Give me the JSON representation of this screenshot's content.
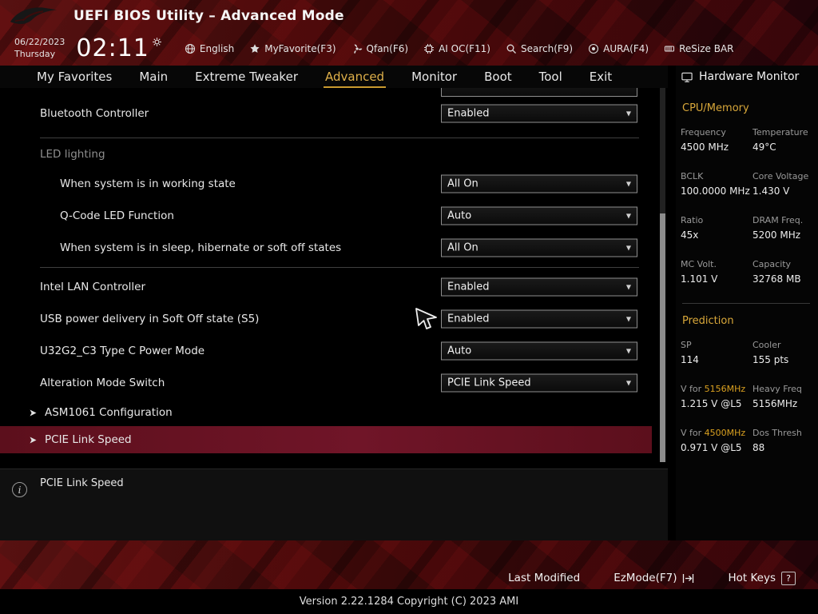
{
  "header": {
    "title": "UEFI BIOS Utility – Advanced Mode",
    "date": "06/22/2023",
    "day": "Thursday",
    "time": "02:11",
    "toolbar": [
      {
        "label": "English",
        "icon": "globe-icon"
      },
      {
        "label": "MyFavorite(F3)",
        "icon": "star-icon"
      },
      {
        "label": "Qfan(F6)",
        "icon": "fan-icon"
      },
      {
        "label": "AI OC(F11)",
        "icon": "chip-icon"
      },
      {
        "label": "Search(F9)",
        "icon": "search-icon"
      },
      {
        "label": "AURA(F4)",
        "icon": "aura-icon"
      },
      {
        "label": "ReSize BAR",
        "icon": "resize-bar-icon"
      }
    ]
  },
  "tabs": [
    {
      "label": "My Favorites",
      "active": false
    },
    {
      "label": "Main",
      "active": false
    },
    {
      "label": "Extreme Tweaker",
      "active": false
    },
    {
      "label": "Advanced",
      "active": true
    },
    {
      "label": "Monitor",
      "active": false
    },
    {
      "label": "Boot",
      "active": false
    },
    {
      "label": "Tool",
      "active": false
    },
    {
      "label": "Exit",
      "active": false
    }
  ],
  "settings": {
    "rows": [
      {
        "type": "partial"
      },
      {
        "type": "option",
        "label": "Bluetooth Controller",
        "value": "Enabled",
        "indent": 0
      },
      {
        "type": "section",
        "label": "LED lighting"
      },
      {
        "type": "option",
        "label": "When system is in working state",
        "value": "All On",
        "indent": 1
      },
      {
        "type": "option",
        "label": "Q-Code LED Function",
        "value": "Auto",
        "indent": 1
      },
      {
        "type": "option",
        "label": "When system is in sleep, hibernate or soft off states",
        "value": "All On",
        "indent": 1
      },
      {
        "type": "divider"
      },
      {
        "type": "option",
        "label": "Intel LAN Controller",
        "value": "Enabled",
        "indent": 0
      },
      {
        "type": "option",
        "label": "USB power delivery in Soft Off state (S5)",
        "value": "Enabled",
        "indent": 0
      },
      {
        "type": "option",
        "label": "U32G2_C3 Type C Power Mode",
        "value": "Auto",
        "indent": 0
      },
      {
        "type": "option",
        "label": "Alteration Mode Switch",
        "value": "PCIE Link Speed",
        "indent": 0
      },
      {
        "type": "submenu",
        "label": "ASM1061 Configuration",
        "selected": false
      },
      {
        "type": "submenu",
        "label": "PCIE Link Speed",
        "selected": true
      }
    ]
  },
  "description": {
    "text": "PCIE Link Speed"
  },
  "hardware_monitor": {
    "title": "Hardware Monitor",
    "sections": [
      {
        "heading": "CPU/Memory",
        "rows": [
          [
            {
              "label": "Frequency",
              "value": "4500 MHz"
            },
            {
              "label": "Temperature",
              "value": "49°C"
            }
          ],
          [
            {
              "label": "BCLK",
              "value": "100.0000 MHz"
            },
            {
              "label": "Core Voltage",
              "value": "1.430 V"
            }
          ],
          [
            {
              "label": "Ratio",
              "value": "45x"
            },
            {
              "label": "DRAM Freq.",
              "value": "5200 MHz"
            }
          ],
          [
            {
              "label": "MC Volt.",
              "value": "1.101 V"
            },
            {
              "label": "Capacity",
              "value": "32768 MB"
            }
          ]
        ]
      },
      {
        "heading": "Prediction",
        "rows": [
          [
            {
              "label": "SP",
              "value": "114"
            },
            {
              "label": "Cooler",
              "value": "155 pts"
            }
          ],
          [
            {
              "label": "V for ",
              "label_accent": "5156MHz",
              "value": "1.215 V @L5"
            },
            {
              "label": "Heavy Freq",
              "value": "5156MHz"
            }
          ],
          [
            {
              "label": "V for ",
              "label_accent": "4500MHz",
              "value": "0.971 V @L5"
            },
            {
              "label": "Dos Thresh",
              "value": "88"
            }
          ]
        ]
      }
    ]
  },
  "footer": {
    "last_modified": "Last Modified",
    "ezmode": "EzMode(F7)",
    "hot_keys": "Hot Keys",
    "hot_keys_badge": "?",
    "version": "Version 2.22.1284 Copyright (C) 2023 AMI"
  },
  "colors": {
    "accent_gold": "#d9a83a",
    "selected_row": "#6a1322",
    "header_red": "#3a0808"
  }
}
